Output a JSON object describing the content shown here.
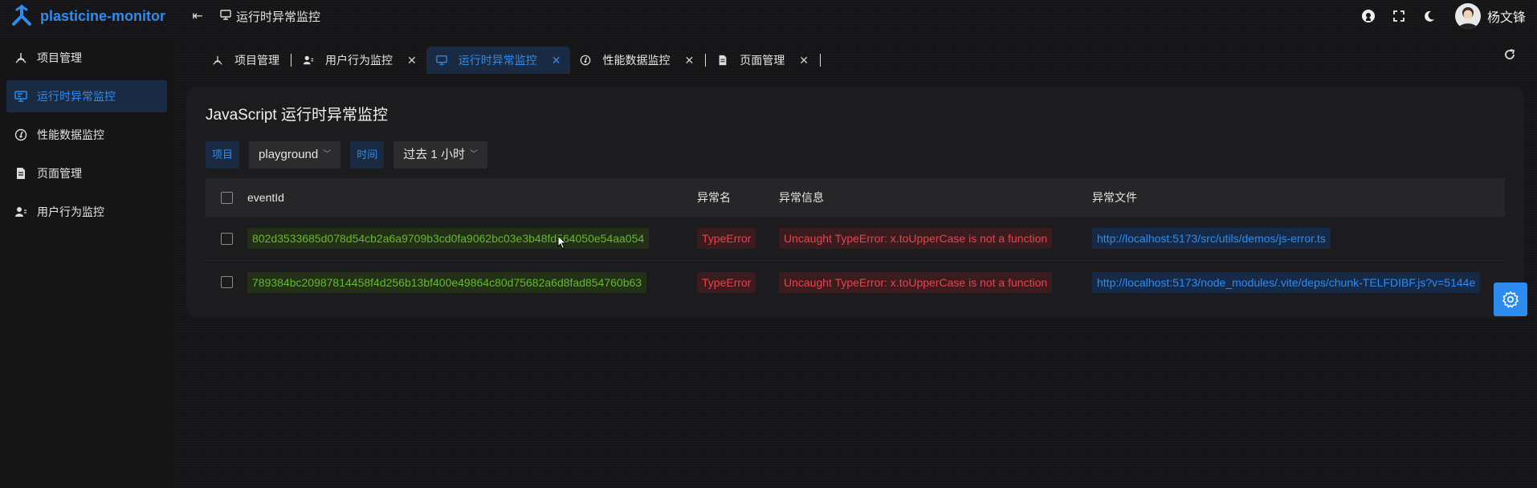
{
  "app": {
    "name": "plasticine-monitor",
    "page_title": "运行时异常监控"
  },
  "user": {
    "name": "杨文锋"
  },
  "sidebar": {
    "items": [
      {
        "label": "项目管理",
        "icon": "project-icon",
        "active": false
      },
      {
        "label": "运行时异常监控",
        "icon": "monitor-icon",
        "active": true
      },
      {
        "label": "性能数据监控",
        "icon": "performance-icon",
        "active": false
      },
      {
        "label": "页面管理",
        "icon": "page-icon",
        "active": false
      },
      {
        "label": "用户行为监控",
        "icon": "user-behavior-icon",
        "active": false
      }
    ]
  },
  "tabs": [
    {
      "label": "项目管理",
      "icon": "project-icon",
      "closable": false,
      "active": false
    },
    {
      "label": "用户行为监控",
      "icon": "user-behavior-icon",
      "closable": true,
      "active": false
    },
    {
      "label": "运行时异常监控",
      "icon": "monitor-icon",
      "closable": true,
      "active": true
    },
    {
      "label": "性能数据监控",
      "icon": "performance-icon",
      "closable": true,
      "active": false
    },
    {
      "label": "页面管理",
      "icon": "page-icon",
      "closable": true,
      "active": false
    }
  ],
  "card": {
    "title": "JavaScript 运行时异常监控",
    "filters": {
      "project_label": "项目",
      "project_value": "playground",
      "time_label": "时间",
      "time_value": "过去 1 小时"
    }
  },
  "table": {
    "headers": [
      "eventId",
      "异常名",
      "异常信息",
      "异常文件"
    ],
    "rows": [
      {
        "eventId": "802d3533685d078d54cb2a6a9709b3cd0fa9062bc03e3b48fd564050e54aa054",
        "name": "TypeError",
        "message": "Uncaught TypeError: x.toUpperCase is not a function",
        "file": "http://localhost:5173/src/utils/demos/js-error.ts"
      },
      {
        "eventId": "789384bc20987814458f4d256b13bf400e49864c80d75682a6d8fad854760b63",
        "name": "TypeError",
        "message": "Uncaught TypeError: x.toUpperCase is not a function",
        "file": "http://localhost:5173/node_modules/.vite/deps/chunk-TELFDIBF.js?v=5144e"
      }
    ]
  },
  "colors": {
    "accent": "#2d8cf0",
    "success": "#63ba2a",
    "error": "#e8434e"
  }
}
